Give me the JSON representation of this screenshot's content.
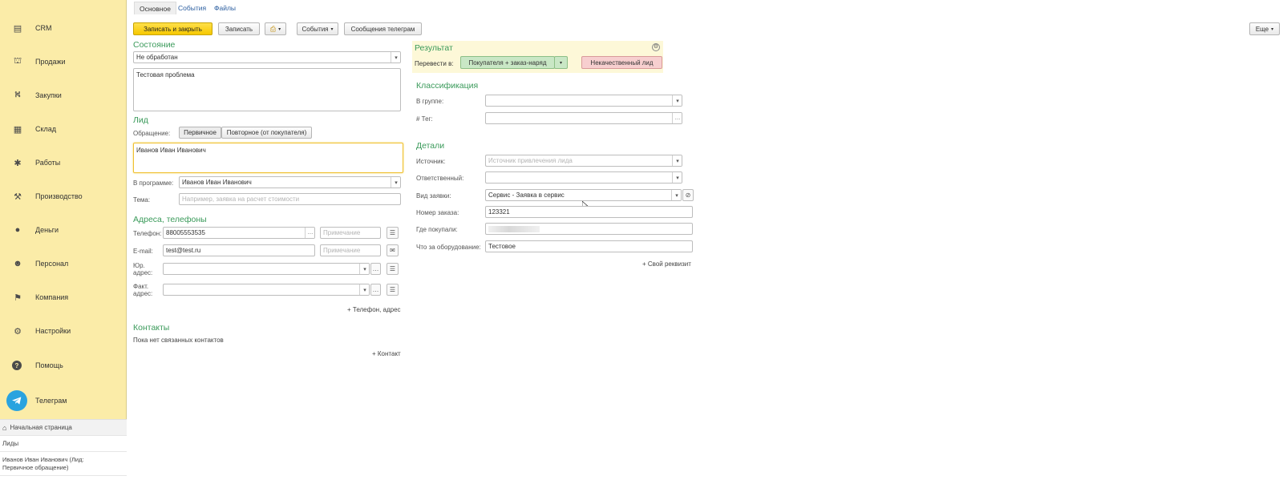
{
  "sidebar": {
    "items": [
      {
        "label": "CRM",
        "icon": "crm-icon",
        "glyph": "▤"
      },
      {
        "label": "Продажи",
        "icon": "sales-icon",
        "glyph": "⛫"
      },
      {
        "label": "Закупки",
        "icon": "purchases-icon",
        "glyph": "⛕"
      },
      {
        "label": "Склад",
        "icon": "warehouse-icon",
        "glyph": "▦"
      },
      {
        "label": "Работы",
        "icon": "works-icon",
        "glyph": "✱"
      },
      {
        "label": "Производство",
        "icon": "production-icon",
        "glyph": "⚒"
      },
      {
        "label": "Деньги",
        "icon": "money-icon",
        "glyph": "●"
      },
      {
        "label": "Персонал",
        "icon": "staff-icon",
        "glyph": "☻"
      },
      {
        "label": "Компания",
        "icon": "company-icon",
        "glyph": "⚑"
      },
      {
        "label": "Настройки",
        "icon": "settings-icon",
        "glyph": "⚙"
      },
      {
        "label": "Помощь",
        "icon": "help-icon",
        "glyph": "?"
      },
      {
        "label": "Телеграм",
        "icon": "telegram-icon",
        "glyph": ""
      }
    ],
    "home_label": "Начальная страница",
    "leads_label": "Лиды",
    "current_doc_label": "Иванов Иван Иванович (Лид: Первичное обращение)"
  },
  "tabs": [
    {
      "label": "Основное"
    },
    {
      "label": "События"
    },
    {
      "label": "Файлы"
    }
  ],
  "toolbar": {
    "save_close": "Записать и закрыть",
    "save": "Записать",
    "print_glyph": "⎙",
    "events": "События",
    "telegram_messages": "Сообщения телеграм",
    "more": "Еще"
  },
  "left": {
    "state_title": "Состояние",
    "state_value": "Не обработан",
    "problem_text": "Тестовая проблема",
    "lead_title": "Лид",
    "appeal_label": "Обращение:",
    "appeal_primary": "Первичное",
    "appeal_repeat": "Повторное (от покупателя)",
    "lead_name": "Иванов Иван Иванович",
    "in_program_label": "В программе:",
    "in_program_value": "Иванов Иван Иванович",
    "topic_label": "Тема:",
    "topic_placeholder": "Например, заявка на расчет стоимости",
    "addresses_title": "Адреса, телефоны",
    "phone_label": "Телефон:",
    "phone_value": "88005553535",
    "note_placeholder": "Примечание",
    "email_label": "E-mail:",
    "email_value": "test@test.ru",
    "legal_address_label": "Юр. адрес:",
    "actual_address_label": "Факт. адрес:",
    "add_phone_address": "+ Телефон, адрес",
    "contacts_title": "Контакты",
    "no_contacts": "Пока нет связанных контактов",
    "add_contact": "+ Контакт"
  },
  "right": {
    "result_title": "Результат",
    "convert_label": "Перевести в:",
    "convert_value": "Покупателя + заказ-наряд",
    "bad_lead": "Некачественный лид",
    "classification_title": "Классификация",
    "group_label": "В группе:",
    "tag_label": "# Тег:",
    "details_title": "Детали",
    "source_label": "Источник:",
    "source_placeholder": "Источник привлечения лида",
    "responsible_label": "Ответственный:",
    "request_type_label": "Вид заявки:",
    "request_type_value": "Сервис - Заявка в сервис",
    "order_no_label": "Номер заказа:",
    "order_no_value": "123321",
    "where_bought_label": "Где покупали:",
    "equipment_label": "Что за оборудование:",
    "equipment_value": "Тестовое",
    "add_attribute": "+ Свой реквизит"
  },
  "colors": {
    "sidebar_bg": "#fbeca8",
    "primary_button": "#f6c800",
    "section_title": "#3a9a5a",
    "convert_button": "#c9e7c5",
    "bad_lead_button": "#f7cfcf",
    "result_panel": "#fdf8d8",
    "focus_border": "#f0c030"
  }
}
